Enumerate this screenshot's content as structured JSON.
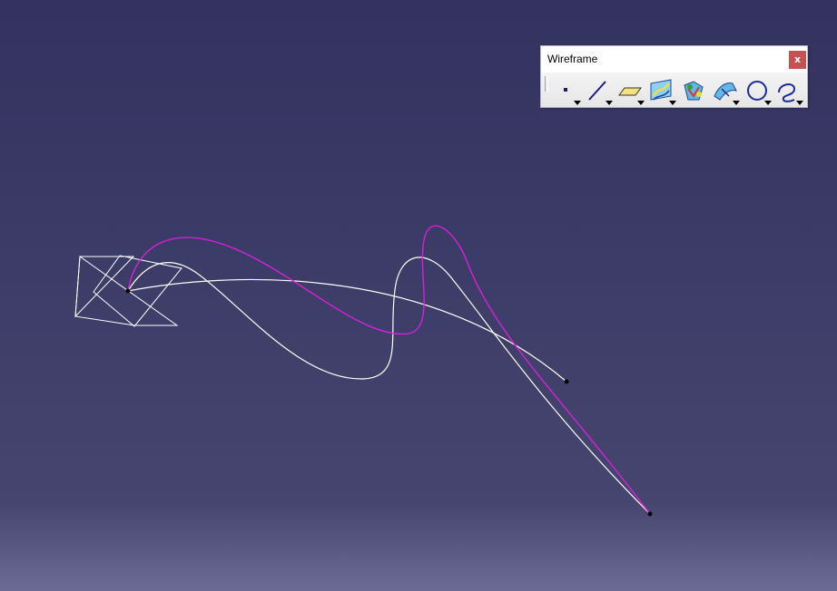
{
  "toolbar": {
    "title": "Wireframe",
    "close_label": "x",
    "tools": [
      {
        "name": "point-tool",
        "icon": "point-icon",
        "has_dropdown": true
      },
      {
        "name": "line-tool",
        "icon": "line-icon",
        "has_dropdown": true
      },
      {
        "name": "plane-tool",
        "icon": "plane-icon",
        "has_dropdown": true
      },
      {
        "name": "projection-tool",
        "icon": "projection-icon",
        "has_dropdown": true
      },
      {
        "name": "intersection-tool",
        "icon": "intersection-icon",
        "has_dropdown": false
      },
      {
        "name": "offset-tool",
        "icon": "offset-icon",
        "has_dropdown": true
      },
      {
        "name": "circle-tool",
        "icon": "circle-icon",
        "has_dropdown": true
      },
      {
        "name": "spline-tool",
        "icon": "spline-icon",
        "has_dropdown": true
      }
    ]
  },
  "viewport": {
    "background_top": "#343462",
    "background_bottom": "#6a6a95",
    "curve_colors": {
      "white_curve": "#ffffff",
      "magenta_curve": "#e01ee0",
      "axis_system": "#ffffff",
      "points": "#000000"
    }
  }
}
